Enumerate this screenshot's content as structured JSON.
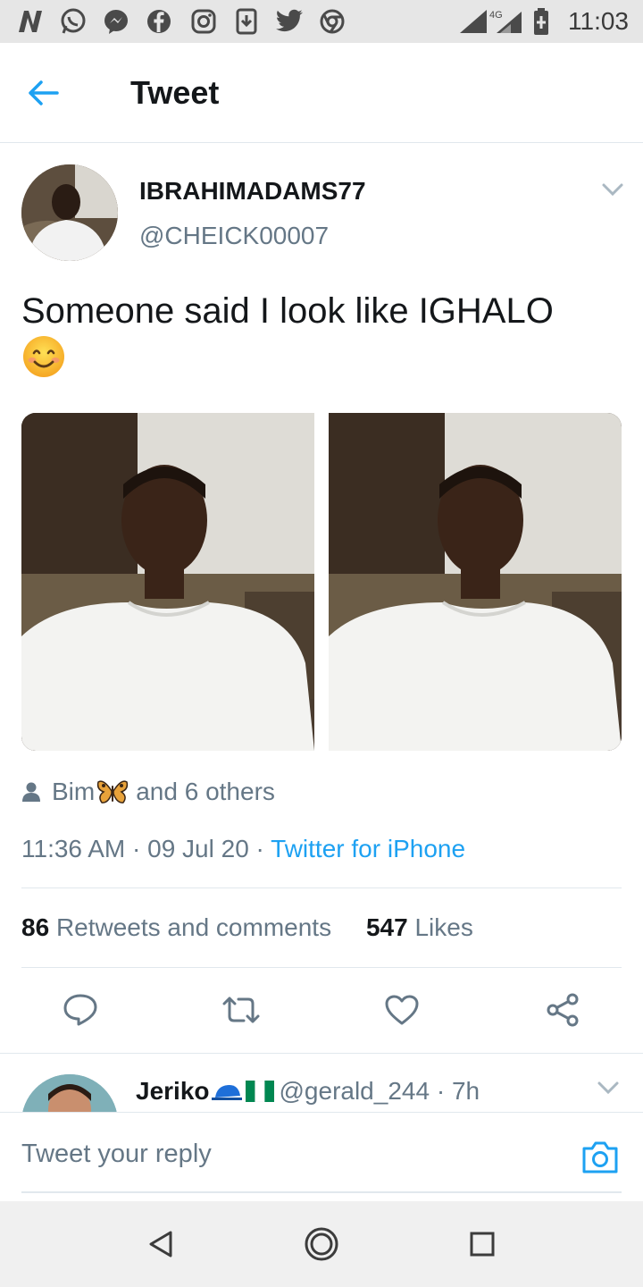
{
  "status_bar": {
    "time": "11:03",
    "network": "4G"
  },
  "header": {
    "title": "Tweet"
  },
  "tweet": {
    "display_name": "IBRAHIMADAMS77",
    "handle": "@CHEICK00007",
    "text": "Someone said I look like IGHALO",
    "emoji": "smiling-face-icon",
    "likers_name": "Bim",
    "likers_rest": "and 6 others",
    "time": "11:36 AM",
    "date": "09 Jul 20",
    "source": "Twitter for iPhone",
    "retweets_count": "86",
    "retweets_label": "Retweets and comments",
    "likes_count": "547",
    "likes_label": "Likes"
  },
  "reply": {
    "name": "Jeriko",
    "handle": "@gerald_244",
    "time": "7h"
  },
  "compose": {
    "placeholder": "Tweet your reply"
  },
  "colors": {
    "accent": "#1da1f2",
    "secondary_text": "#657786",
    "primary_text": "#14171a"
  }
}
